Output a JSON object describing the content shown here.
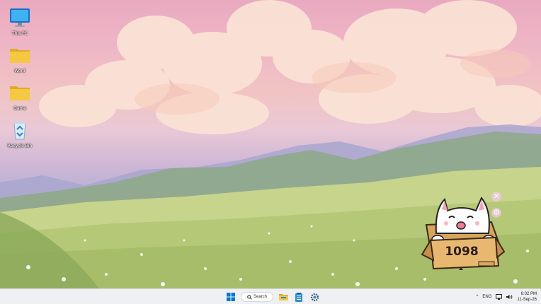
{
  "desktop": {
    "icons": [
      {
        "label": "This PC",
        "icon": "monitor-icon"
      },
      {
        "label": "Word",
        "icon": "folder-icon"
      },
      {
        "label": "Game",
        "icon": "folder-icon"
      },
      {
        "label": "Recycle Bin",
        "icon": "recycle-bin-icon"
      }
    ]
  },
  "widget": {
    "counter": "1098",
    "close_icon": "close-icon",
    "settings_icon": "gear-icon"
  },
  "taskbar": {
    "search_label": "Search",
    "language": "ENG",
    "time": "6:02 PM",
    "date": "11-Sep-26",
    "icons": [
      "windows-start-icon",
      "search-icon",
      "file-explorer-icon",
      "notepad-icon",
      "settings-icon",
      "chevron-up-icon",
      "network-icon",
      "volume-icon"
    ]
  },
  "colors": {
    "taskbar_bg": "#eef0f4",
    "folder": "#f5c842",
    "accent": "#0078d4"
  }
}
